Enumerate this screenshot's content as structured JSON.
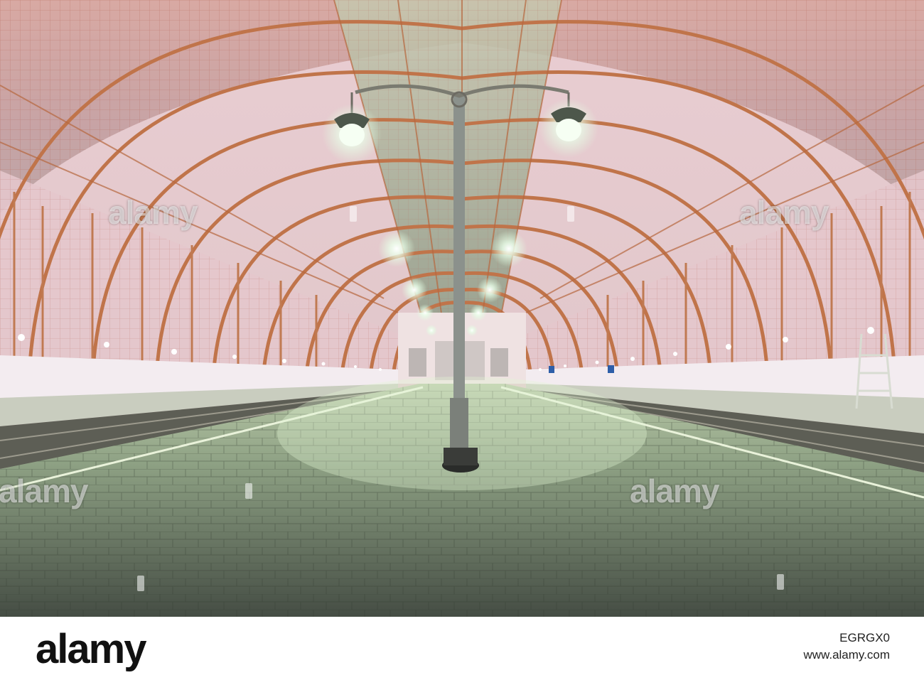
{
  "watermark": {
    "text": "alamy"
  },
  "footer": {
    "brand": "alamy",
    "image_id": "EGRGX0",
    "site": "www.alamy.com"
  },
  "colors": {
    "roof_frame": "#c97b4e",
    "roof_glass": "#e6c2c4",
    "roof_center_panel": "#a8b49a",
    "platform": "#8fa085",
    "lamp_glow": "#f3fff0",
    "wall_tone": "#efd8dc"
  }
}
